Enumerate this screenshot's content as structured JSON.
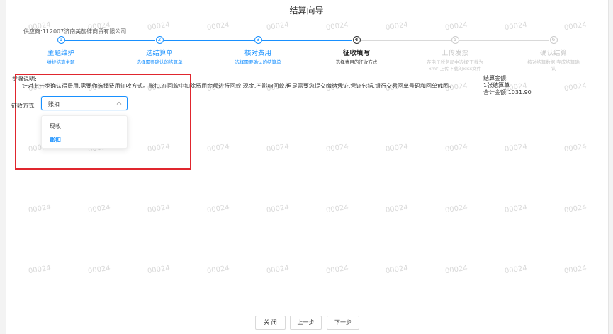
{
  "header": {
    "title": "结算向导"
  },
  "supplier": "供应商:112007济南美旋律商贸有限公司",
  "steps": [
    {
      "num": "1",
      "title": "主题维护",
      "desc": "维护结算主题"
    },
    {
      "num": "2",
      "title": "选结算单",
      "desc": "选择需要确认的结算单"
    },
    {
      "num": "3",
      "title": "核对费用",
      "desc": "选择需要确认的结算单"
    },
    {
      "num": "4",
      "title": "征收填写",
      "desc": "选择费用的征收方式"
    },
    {
      "num": "5",
      "title": "上传发票",
      "desc1": "在电子税务局中选择'下载为",
      "desc2": "xml',上传下载的xlsx文件"
    },
    {
      "num": "6",
      "title": "确认结算",
      "desc1": "核对结算数据,完成结算确",
      "desc2": "认"
    }
  ],
  "instructions": {
    "label": "步骤说明:",
    "text": "针对上一步确认得费用,需要你选择费用征收方式。账扣,在回款中扣除费用金额进行回款;现金,不影响回款,但是需要您提交缴纳凭证,凭证包括,银行交易回单号码和回单截图。"
  },
  "summary": {
    "label": "结算金额:",
    "count": "1张结算单",
    "total": "合计金额:1031.90"
  },
  "form": {
    "label": "征收方式:",
    "selected": "账扣",
    "options": [
      "现收",
      "账扣"
    ]
  },
  "buttons": {
    "close": "关 闭",
    "prev": "上一步",
    "next": "下一步"
  },
  "watermark": "00024",
  "colors": {
    "primary": "#1890ff",
    "highlight_box": "#e0262e",
    "watermark": "#dadada"
  }
}
